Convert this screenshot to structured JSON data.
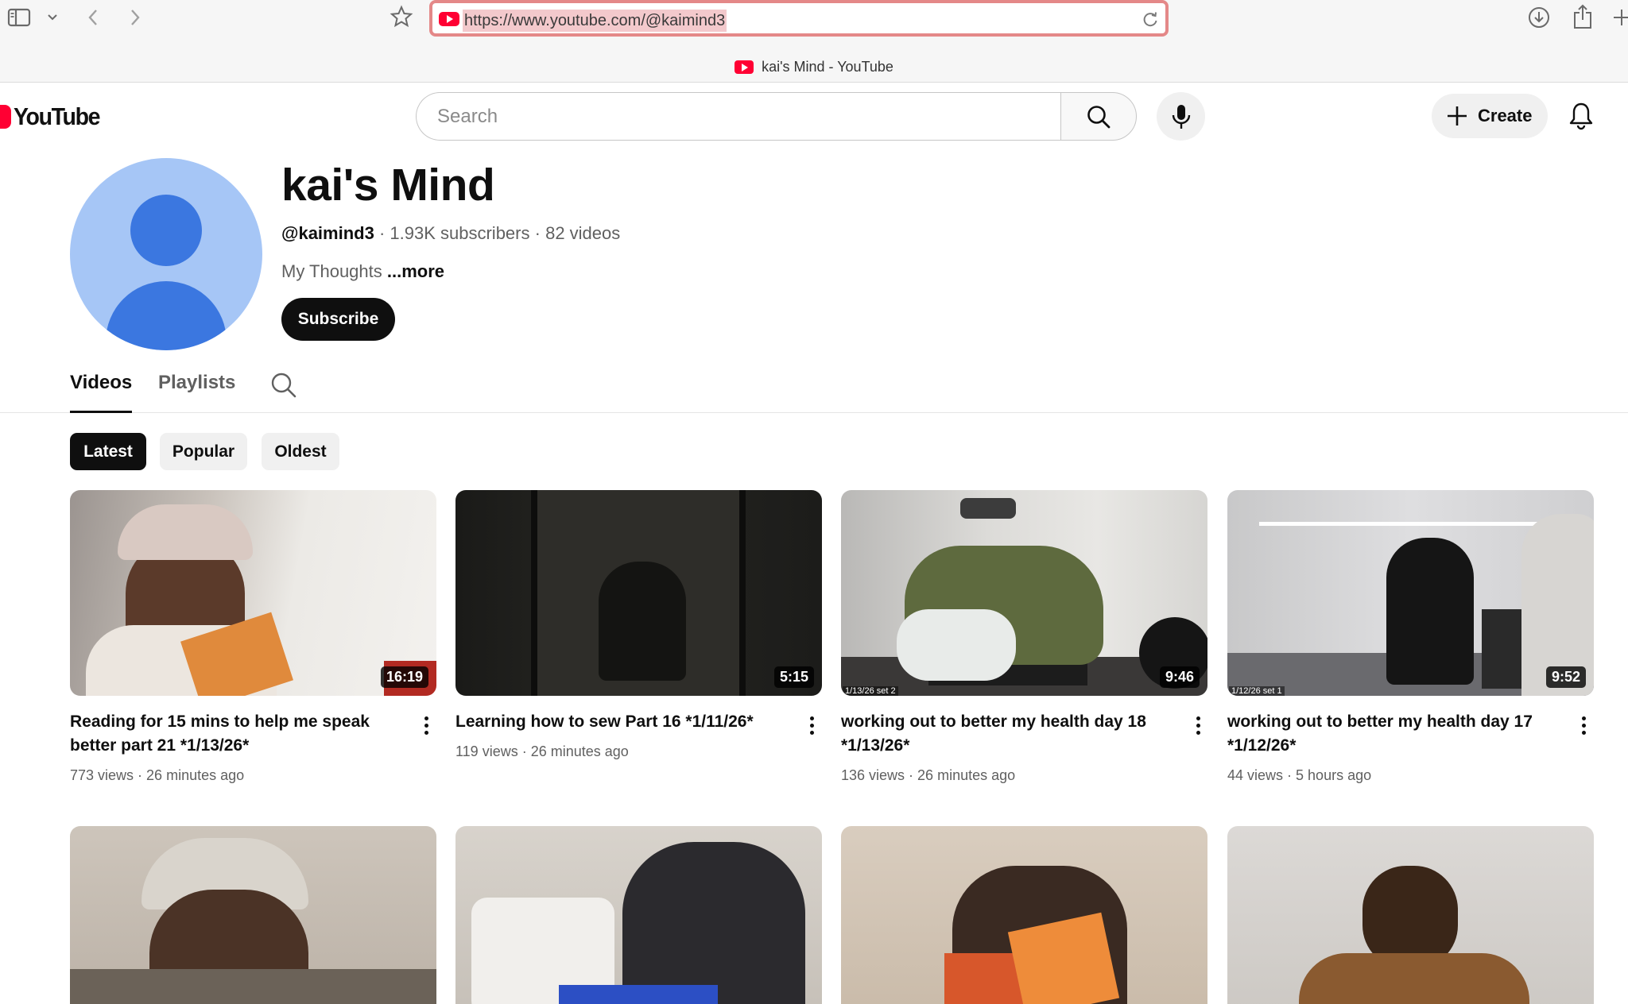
{
  "browser": {
    "url": "https://www.youtube.com/@kaimind3",
    "tab_title": "kai's Mind - YouTube"
  },
  "header": {
    "logo_text": "YouTube",
    "search_placeholder": "Search",
    "create_label": "Create"
  },
  "channel": {
    "name": "kai's Mind",
    "handle": "@kaimind3",
    "subscribers": "1.93K subscribers",
    "videos_count": "82 videos",
    "description": "My Thoughts",
    "more_label": "...more",
    "subscribe_label": "Subscribe"
  },
  "tabs": [
    {
      "label": "Videos",
      "active": true
    },
    {
      "label": "Playlists",
      "active": false
    }
  ],
  "chips": [
    {
      "label": "Latest",
      "selected": true
    },
    {
      "label": "Popular",
      "selected": false
    },
    {
      "label": "Oldest",
      "selected": false
    }
  ],
  "videos": [
    {
      "title": "Reading for 15 mins to help me speak better part 21 *1/13/26*",
      "views": "773 views",
      "age": "26 minutes ago",
      "duration": "16:19"
    },
    {
      "title": "Learning how to sew Part 16 *1/11/26*",
      "views": "119 views",
      "age": "26 minutes ago",
      "duration": "5:15"
    },
    {
      "title": "working out to better my health day 18 *1/13/26*",
      "views": "136 views",
      "age": "26 minutes ago",
      "duration": "9:46",
      "stamp": "1/13/26 set 2"
    },
    {
      "title": "working out to better my health day 17 *1/12/26*",
      "views": "44 views",
      "age": "5 hours ago",
      "duration": "9:52",
      "stamp": "1/12/26 set 1"
    }
  ],
  "colors": {
    "youtube_red": "#ff0033",
    "text_primary": "#0f0f0f",
    "text_secondary": "#606060",
    "avatar_bg": "#a6c6f6",
    "avatar_fg": "#3b77e0"
  }
}
